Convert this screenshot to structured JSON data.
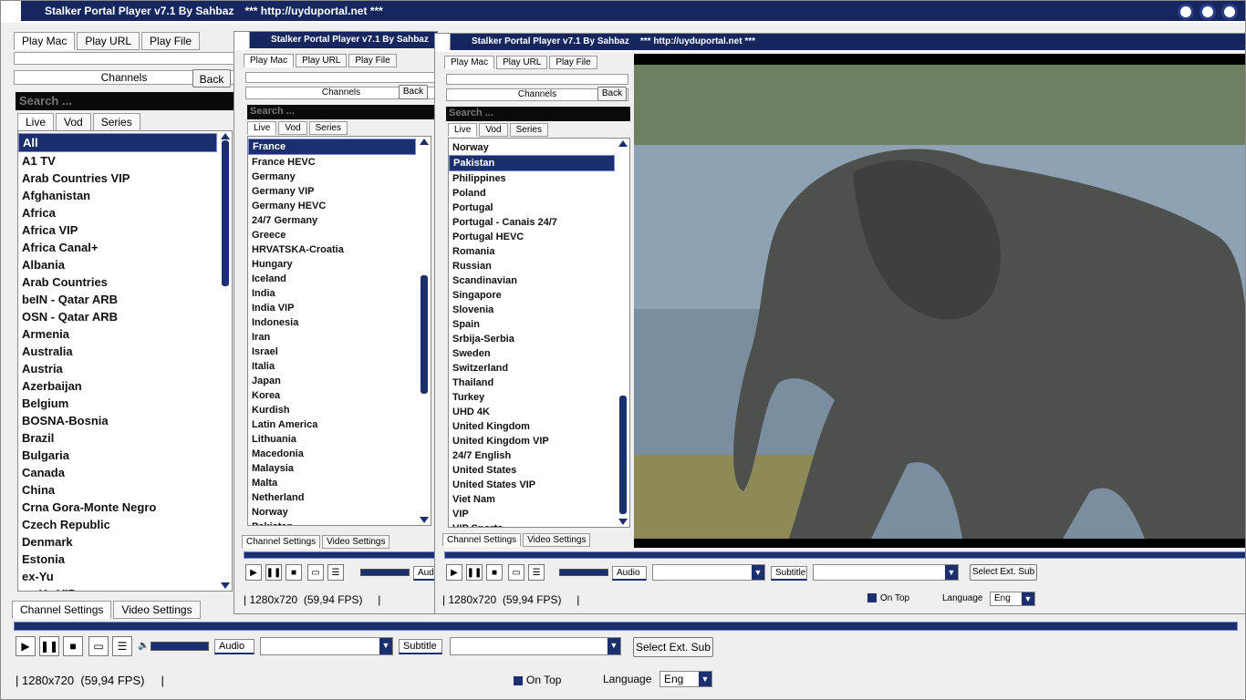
{
  "app_title": "Stalker Portal Player v7.1 By Sahbaz",
  "app_url": "*** http://uyduportal.net ***",
  "tabs": [
    "Play Mac",
    "Play URL",
    "Play File"
  ],
  "channels_label": "Channels",
  "back_label": "Back",
  "search_placeholder": "Search ...",
  "content_tabs": [
    "Live",
    "Vod",
    "Series"
  ],
  "settings_tabs": [
    "Channel Settings",
    "Video Settings"
  ],
  "audio_label": "Audio",
  "subtitle_label": "Subtitle",
  "select_ext_sub": "Select Ext. Sub",
  "status_resolution": "1280x720",
  "status_fps": "(59,94 FPS)",
  "on_top": "On Top",
  "language_label": "Language",
  "language_value": "Eng",
  "list1": [
    "All",
    "A1 TV",
    "Arab Countries VIP",
    "Afghanistan",
    "Africa",
    "Africa VIP",
    "Africa Canal+",
    "Albania",
    "Arab Countries",
    "beIN - Qatar ARB",
    "OSN - Qatar ARB",
    "Armenia",
    "Australia",
    "Austria",
    "Azerbaijan",
    "Belgium",
    "BOSNA-Bosnia",
    "Brazil",
    "Bulgaria",
    "Canada",
    "China",
    "Crna Gora-Monte Negro",
    "Czech Republic",
    "Denmark",
    "Estonia",
    "ex-Yu",
    "ex-Yu VIP"
  ],
  "list2": [
    "France",
    "France HEVC",
    "Germany",
    "Germany VIP",
    "Germany HEVC",
    "24/7 Germany",
    "Greece",
    "HRVATSKA-Croatia",
    "Hungary",
    "Iceland",
    "India",
    "India VIP",
    "Indonesia",
    "Iran",
    "Israel",
    "Italia",
    "Japan",
    "Korea",
    "Kurdish",
    "Latin America",
    "Lithuania",
    "Macedonia",
    "Malaysia",
    "Malta",
    "Netherland",
    "Norway",
    "Pakistan"
  ],
  "list3": [
    "Norway",
    "Pakistan",
    "Philippines",
    "Poland",
    "Portugal",
    "Portugal - Canais 24/7",
    "Portugal HEVC",
    "Romania",
    "Russian",
    "Scandinavian",
    "Singapore",
    "Slovenia",
    "Spain",
    "Srbija-Serbia",
    "Sweden",
    "Switzerland",
    "Thailand",
    "Turkey",
    "UHD 4K",
    "United Kingdom",
    "United Kingdom VIP",
    "24/7 English",
    "United States",
    "United States VIP",
    "Viet Nam",
    "VIP",
    "VIP Sports"
  ]
}
